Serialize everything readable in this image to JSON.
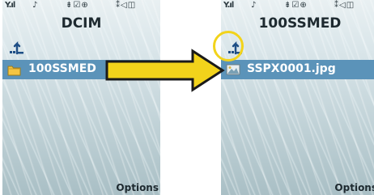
{
  "left_screen": {
    "title": "DCIM",
    "items": [
      {
        "label": "100SSMED",
        "icon": "folder-icon"
      }
    ],
    "softkey": "Options",
    "status": {
      "signal": "Y.ıl",
      "mid": "⇟☑⊕",
      "right": "⁑◁◫"
    }
  },
  "right_screen": {
    "title": "100SSMED",
    "items": [
      {
        "label": "SSPX0001.jpg",
        "icon": "image-file-icon"
      }
    ],
    "softkey": "Options",
    "status": {
      "signal": "Y.ıl",
      "mid": "⇟☑⊕",
      "right": "⁑◁◫"
    }
  },
  "colors": {
    "selection": "#5b93b9",
    "arrow_fill": "#f2d31b",
    "arrow_stroke": "#1a1a1a",
    "highlight_ring": "#f2d31b"
  }
}
